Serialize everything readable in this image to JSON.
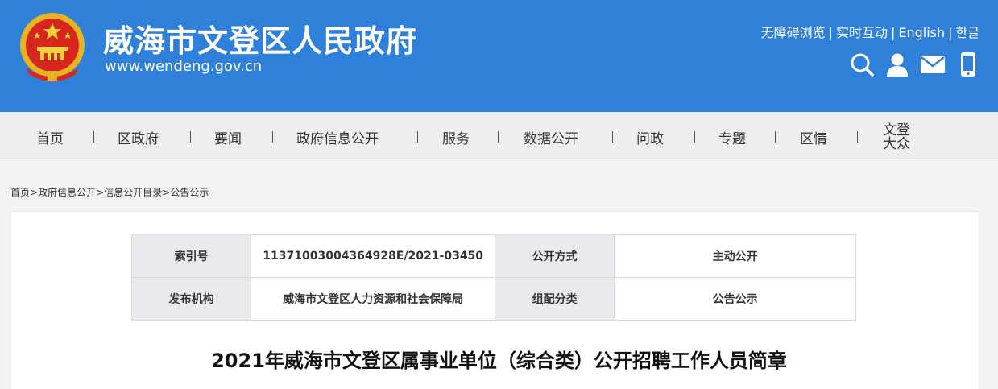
{
  "header": {
    "title": "威海市文登区人民政府",
    "url": "www.wendeng.gov.cn",
    "toplinks": [
      "无障碍浏览",
      "实时互动",
      "English",
      "한글"
    ],
    "icons": [
      "search-icon",
      "user-icon",
      "mail-icon",
      "mobile-icon"
    ]
  },
  "nav": {
    "items": [
      "首页",
      "区政府",
      "要闻",
      "政府信息公开",
      "服务",
      "数据公开",
      "问政",
      "专题",
      "区情"
    ],
    "last_line1": "文登",
    "last_line2": "大众"
  },
  "breadcrumb": [
    "首页",
    "政府信息公开",
    "信息公开目录",
    "公告公示"
  ],
  "breadcrumb_sep": ">",
  "meta": {
    "index_label": "索引号",
    "index_value": "11371003004364928E/2021-03450",
    "method_label": "公开方式",
    "method_value": "主动公开",
    "org_label": "发布机构",
    "org_value": "威海市文登区人力资源和社会保障局",
    "category_label": "组配分类",
    "category_value": "公告公示"
  },
  "article": {
    "title": "2021年威海市文登区属事业单位（综合类）公开招聘工作人员简章"
  },
  "colors": {
    "header_bg": "#2f80d9",
    "nav_bg": "#eeeeee",
    "table_label_bg": "#e8eaed"
  }
}
